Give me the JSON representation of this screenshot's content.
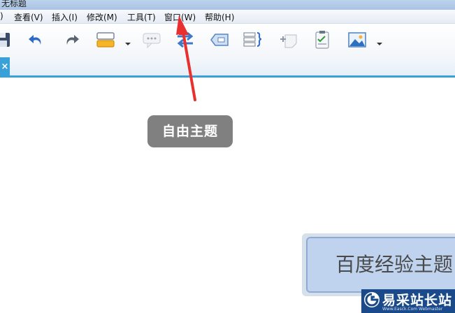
{
  "window": {
    "title": "无标题"
  },
  "menu": [
    {
      "id": "view",
      "label": "查看(V)"
    },
    {
      "id": "insert",
      "label": "插入(I)"
    },
    {
      "id": "modify",
      "label": "修改(M)"
    },
    {
      "id": "tools",
      "label": "工具(T)"
    },
    {
      "id": "window",
      "label": "窗口(W)"
    },
    {
      "id": "help",
      "label": "帮助(H)"
    }
  ],
  "menu_partial": {
    "label": ")"
  },
  "toolbar": {
    "icons": [
      "save-icon",
      "undo-icon",
      "redo-icon",
      "topic-icon",
      "callout-icon",
      "relationship-icon",
      "boundary-icon",
      "summary-icon",
      "marker-icon",
      "task-icon",
      "image-icon"
    ]
  },
  "tab": {
    "close_label": "×"
  },
  "canvas": {
    "floating_topic": "自由主题",
    "main_topic": "百度经验主题"
  },
  "watermark": {
    "brand": "易采站长站",
    "url": "Www.Easck.Com Webmaster"
  },
  "colors": {
    "accent": "#3aa0d8",
    "floating_topic_bg": "#808080",
    "main_topic_bg": "#bfd3ee",
    "arrow": "#e8302f"
  }
}
